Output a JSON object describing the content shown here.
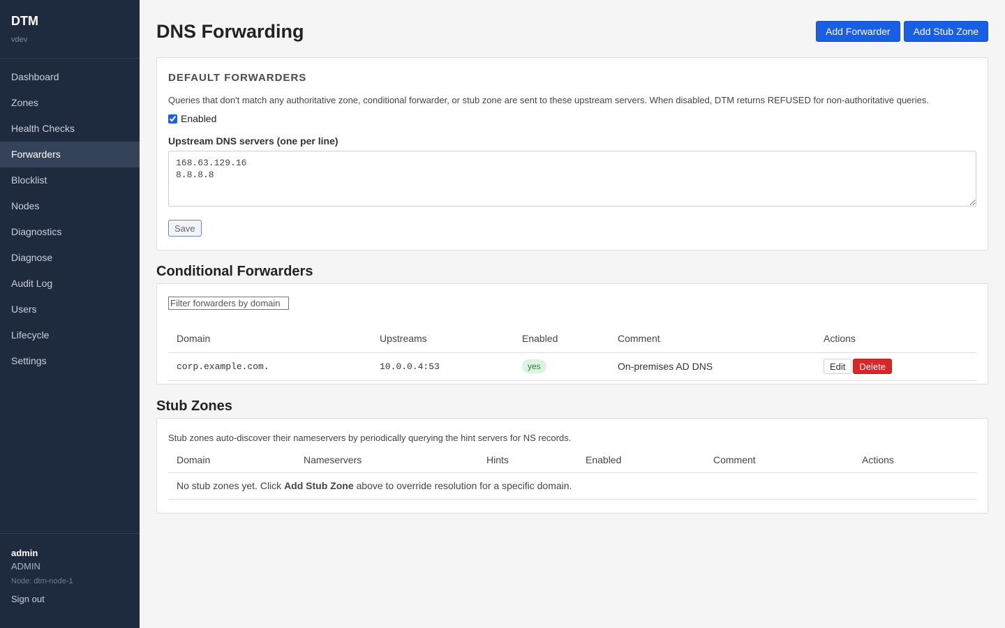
{
  "app": {
    "name": "DTM",
    "version": "vdev"
  },
  "nav": {
    "items": [
      {
        "label": "Dashboard",
        "active": false
      },
      {
        "label": "Zones",
        "active": false
      },
      {
        "label": "Health Checks",
        "active": false
      },
      {
        "label": "Forwarders",
        "active": true
      },
      {
        "label": "Blocklist",
        "active": false
      },
      {
        "label": "Nodes",
        "active": false
      },
      {
        "label": "Diagnostics",
        "active": false
      },
      {
        "label": "Diagnose",
        "active": false
      },
      {
        "label": "Audit Log",
        "active": false
      },
      {
        "label": "Users",
        "active": false
      },
      {
        "label": "Lifecycle",
        "active": false
      },
      {
        "label": "Settings",
        "active": false
      }
    ]
  },
  "user": {
    "name": "admin",
    "role": "ADMIN",
    "node": "Node: dtm-node-1",
    "sign_out": "Sign out"
  },
  "page": {
    "title": "DNS Forwarding",
    "add_forwarder_label": "Add Forwarder",
    "add_stub_zone_label": "Add Stub Zone"
  },
  "default_forwarders": {
    "title": "DEFAULT FORWARDERS",
    "description": "Queries that don't match any authoritative zone, conditional forwarder, or stub zone are sent to these upstream servers. When disabled, DTM returns REFUSED for non-authoritative queries.",
    "enabled_label": "Enabled",
    "enabled": true,
    "upstream_label": "Upstream DNS servers (one per line)",
    "upstream_value": "168.63.129.16\n8.8.8.8",
    "save_label": "Save"
  },
  "conditional": {
    "title": "Conditional Forwarders",
    "filter_placeholder": "Filter forwarders by domain",
    "columns": {
      "domain": "Domain",
      "upstreams": "Upstreams",
      "enabled": "Enabled",
      "comment": "Comment",
      "actions": "Actions"
    },
    "rows": [
      {
        "domain": "corp.example.com.",
        "upstreams": "10.0.0.4:53",
        "enabled": "yes",
        "comment": "On-premises AD DNS",
        "edit": "Edit",
        "delete": "Delete"
      }
    ]
  },
  "stub": {
    "title": "Stub Zones",
    "description": "Stub zones auto-discover their nameservers by periodically querying the hint servers for NS records.",
    "columns": {
      "domain": "Domain",
      "nameservers": "Nameservers",
      "hints": "Hints",
      "enabled": "Enabled",
      "comment": "Comment",
      "actions": "Actions"
    },
    "empty_prefix": "No stub zones yet. Click ",
    "empty_strong": "Add Stub Zone",
    "empty_suffix": " above to override resolution for a specific domain."
  }
}
